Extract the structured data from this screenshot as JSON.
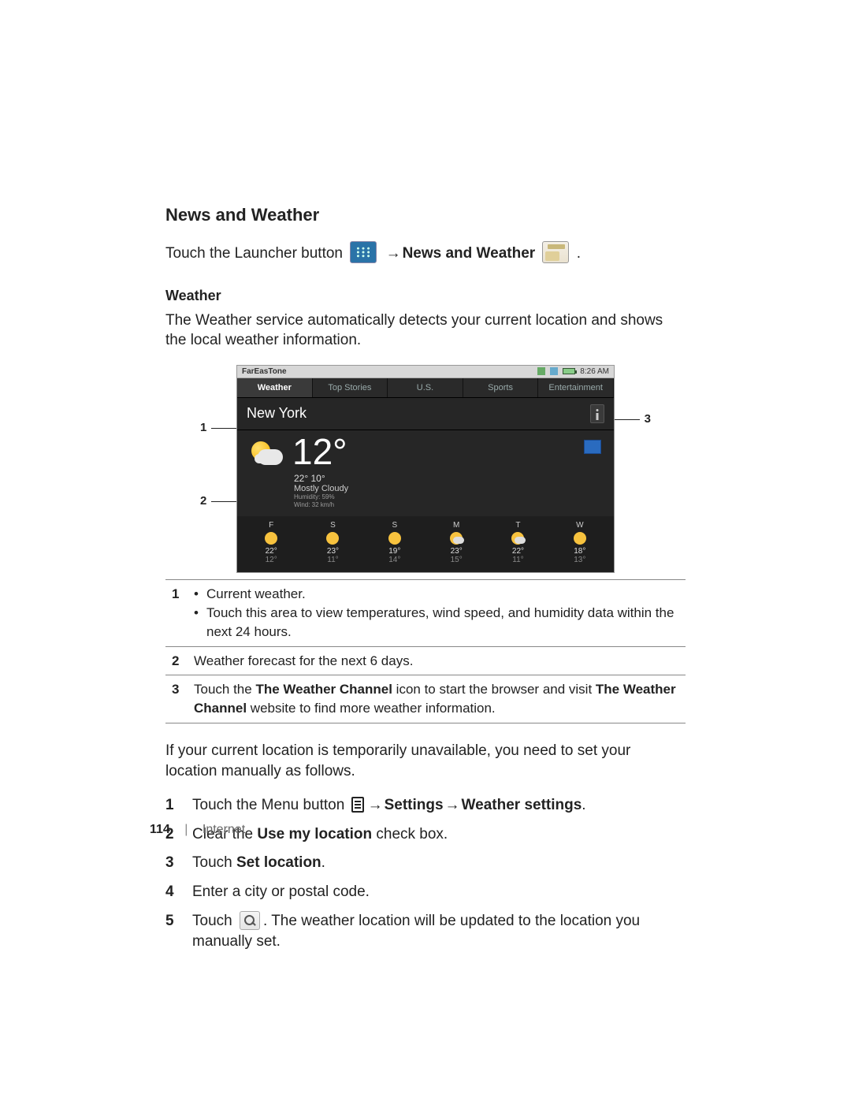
{
  "section_title": "News and Weather",
  "intro": {
    "touch_launcher_prefix": "Touch the Launcher button",
    "arrow": "→",
    "news_and_weather_label": "News and Weather",
    "period": " ."
  },
  "weather": {
    "heading": "Weather",
    "desc": "The Weather service automatically detects your current location and shows the local weather information."
  },
  "screenshot": {
    "statusbar": {
      "carrier": "FarEasTone",
      "time": "8:26 AM"
    },
    "tabs": [
      "Weather",
      "Top Stories",
      "U.S.",
      "Sports",
      "Entertainment"
    ],
    "city": "New York",
    "current": {
      "temp": "12°",
      "high_low": "22°  10°",
      "conditions": "Mostly Cloudy",
      "humidity": "Humidity: 59%",
      "wind": "Wind: 32 km/h"
    },
    "forecast": [
      {
        "d": "F",
        "hi": "22°",
        "lo": "12°",
        "c": "sun"
      },
      {
        "d": "S",
        "hi": "23°",
        "lo": "11°",
        "c": "sun"
      },
      {
        "d": "S",
        "hi": "19°",
        "lo": "14°",
        "c": "sun"
      },
      {
        "d": "M",
        "hi": "23°",
        "lo": "15°",
        "c": "cloud"
      },
      {
        "d": "T",
        "hi": "22°",
        "lo": "11°",
        "c": "cloud"
      },
      {
        "d": "W",
        "hi": "18°",
        "lo": "13°",
        "c": "sun"
      }
    ]
  },
  "callouts": {
    "c1": "1",
    "c2": "2",
    "c3": "3"
  },
  "annotations": {
    "r1_num": "1",
    "r1_b1": "Current weather.",
    "r1_b2": "Touch this area to view temperatures, wind speed, and humidity data within the next 24 hours.",
    "r2_num": "2",
    "r2": "Weather forecast for the next 6 days.",
    "r3_num": "3",
    "r3_a": "Touch the ",
    "r3_b": "The Weather Channel",
    "r3_c": " icon to start the browser and visit ",
    "r3_d": "The Weather Channel",
    "r3_e": " website to find more weather information."
  },
  "post": "If your current location is temporarily unavailable, you need to set your location manually as follows.",
  "steps": {
    "s1_num": "1",
    "s1_a": "Touch the Menu button ",
    "s1_b": "Settings",
    "s1_c": "Weather settings",
    "s2_num": "2",
    "s2_a": "Clear the ",
    "s2_b": "Use my location",
    "s2_c": " check box.",
    "s3_num": "3",
    "s3_a": "Touch ",
    "s3_b": "Set location",
    "s3_c": ".",
    "s4_num": "4",
    "s4": "Enter a city or postal code.",
    "s5_num": "5",
    "s5_a": "Touch ",
    "s5_b": ". The weather location will be updated to the location you manually set."
  },
  "footer": {
    "page": "114",
    "section": "Internet"
  }
}
